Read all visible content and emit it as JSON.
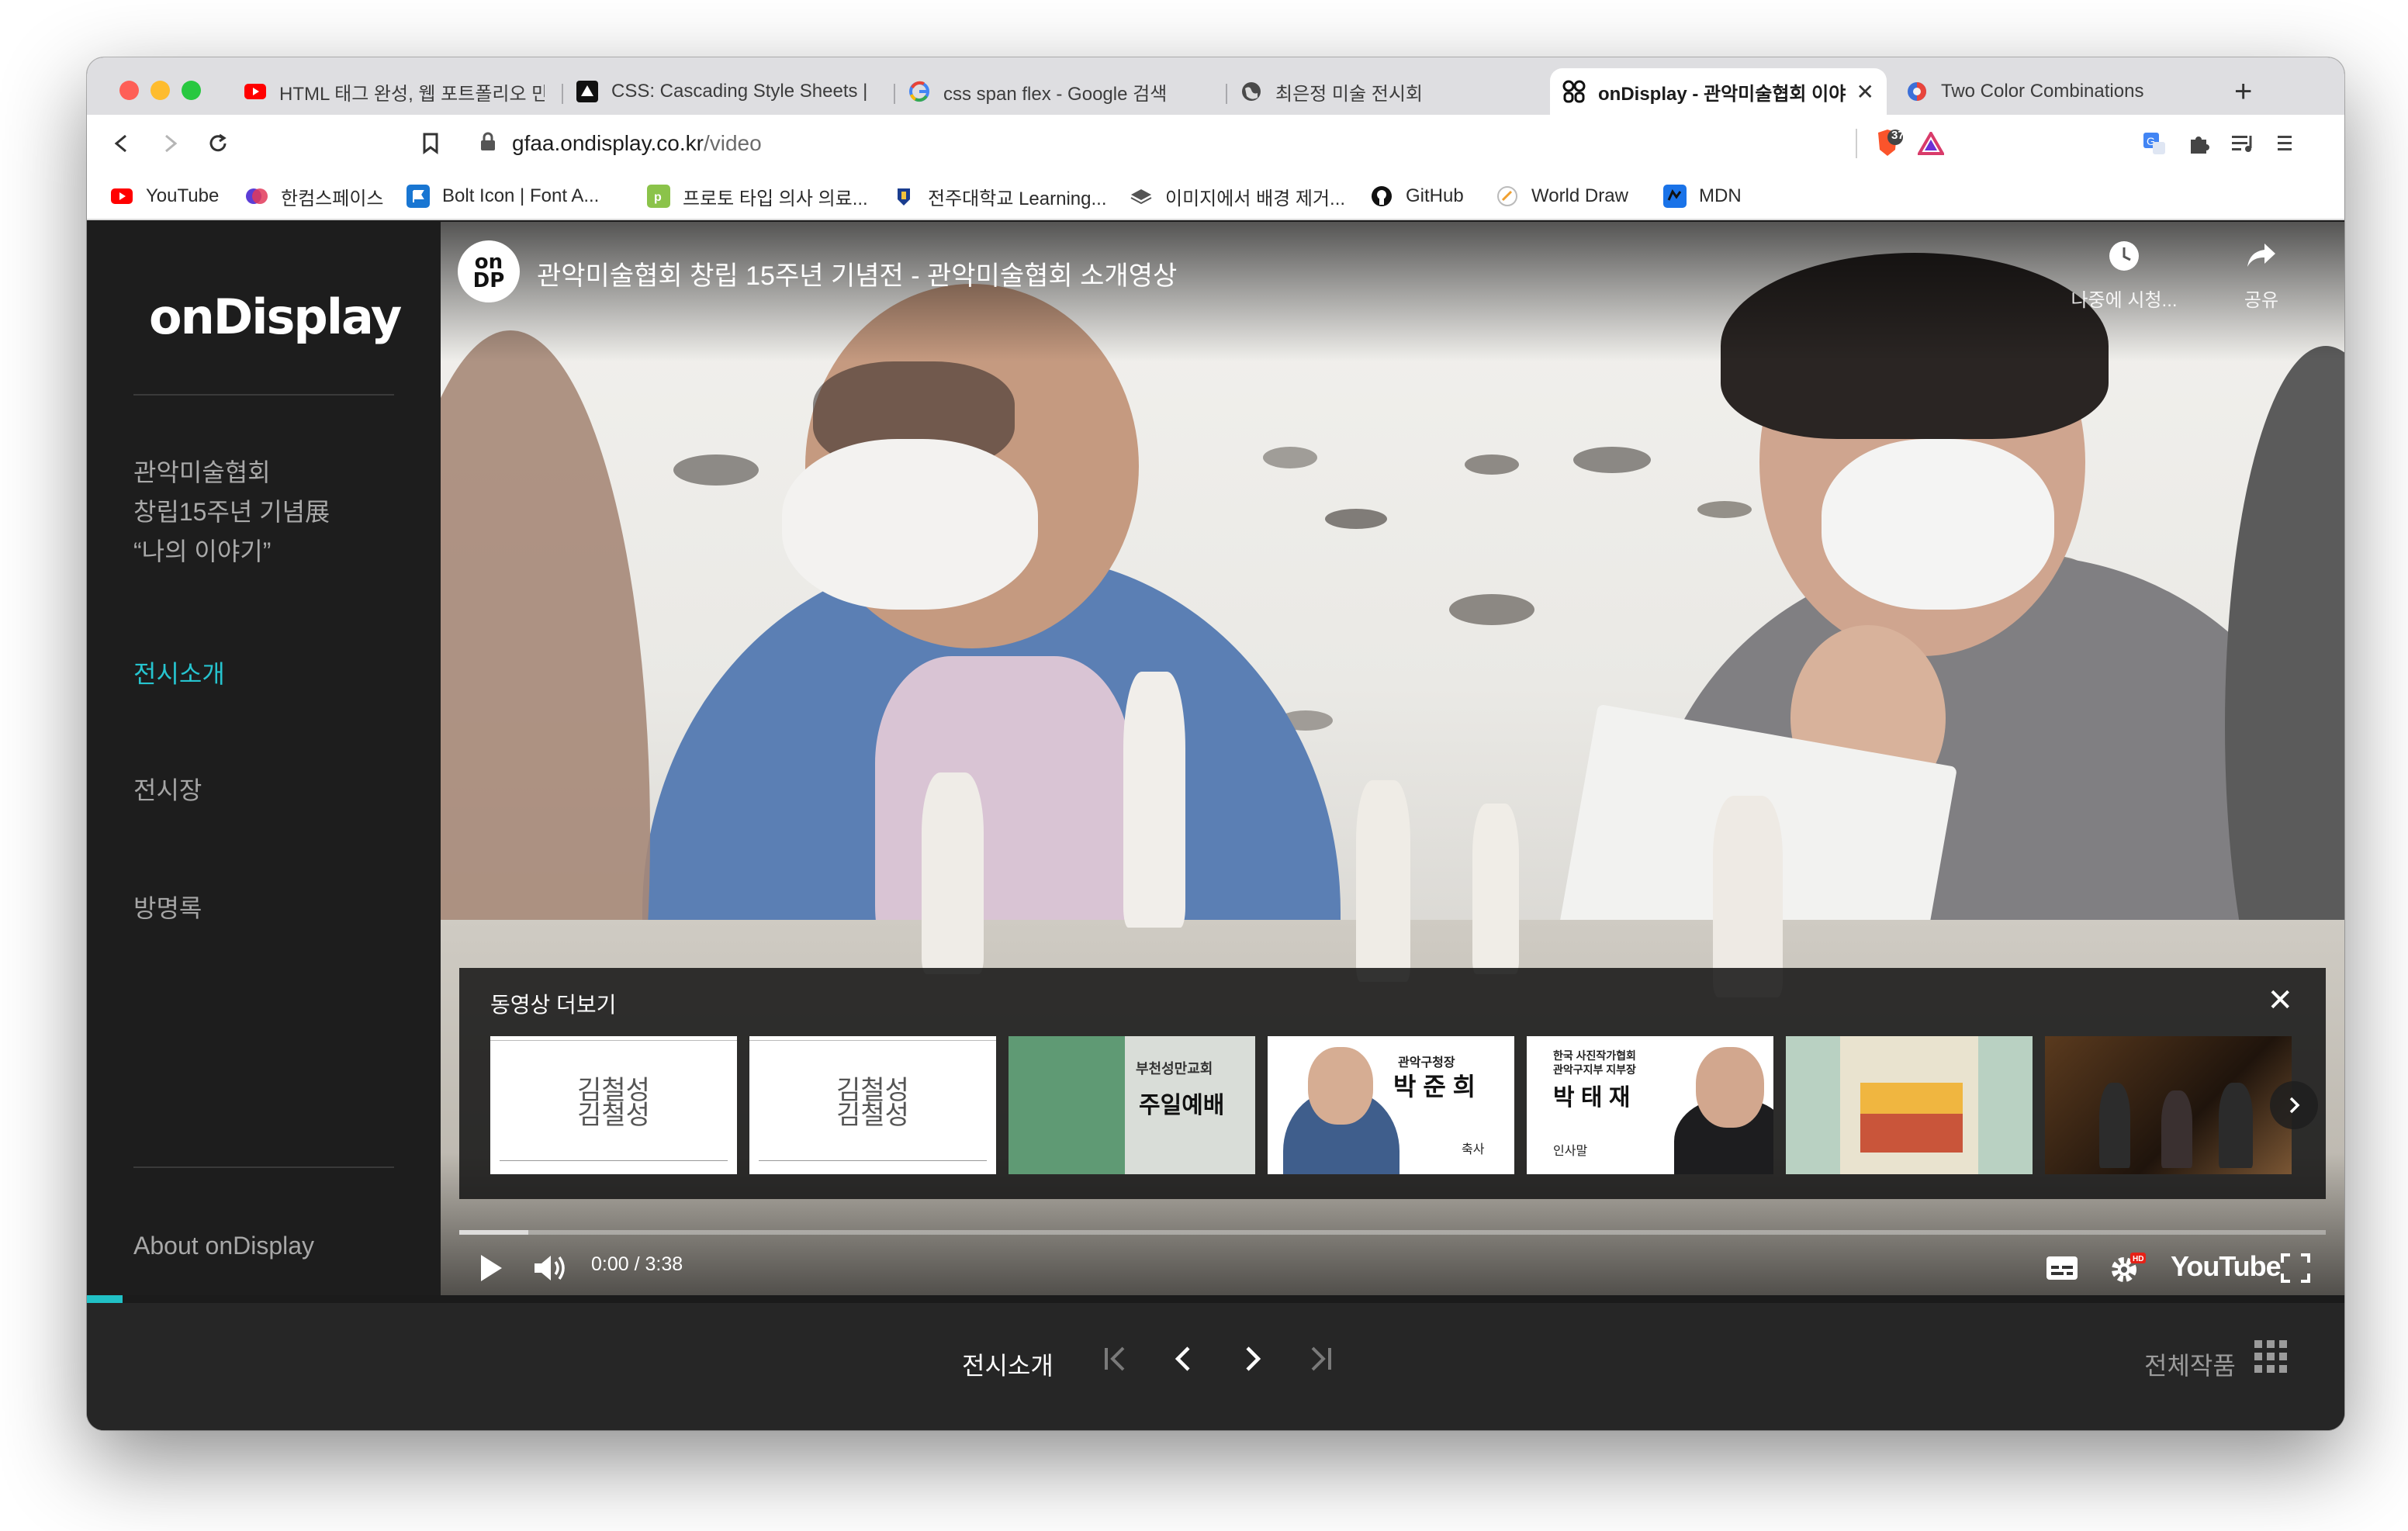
{
  "browser": {
    "tabs": [
      {
        "title": "HTML 태그 완성, 웹 포트폴리오 만들",
        "icon": "youtube-icon"
      },
      {
        "title": "CSS: Cascading Style Sheets |",
        "icon": "mdn-icon"
      },
      {
        "title": "css span flex - Google 검색",
        "icon": "google-icon"
      },
      {
        "title": "최은정 미술 전시회",
        "icon": "globe-icon"
      },
      {
        "title": "onDisplay - 관악미술협회 이야",
        "icon": "ondisplay-icon",
        "active": true
      },
      {
        "title": "Two Color Combinations",
        "icon": "globe-icon"
      }
    ],
    "url_host": "gfaa.ondisplay.co.kr",
    "url_path": "/video",
    "brave_badge": "37",
    "bookmarks": [
      {
        "label": "YouTube",
        "color": "#e62117"
      },
      {
        "label": "한컴스페이스",
        "color": "#5b3dd6"
      },
      {
        "label": "Bolt Icon | Font A...",
        "color": "#1976d2"
      },
      {
        "label": "프로토 타입 의사 의료...",
        "color": "#8bc34a"
      },
      {
        "label": "전주대학교 Learning...",
        "color": "#1a3d8f"
      },
      {
        "label": "이미지에서 배경 제거...",
        "color": "#555555"
      },
      {
        "label": "GitHub",
        "color": "#111111"
      },
      {
        "label": "World Draw",
        "color": "#f0c040"
      },
      {
        "label": "MDN",
        "color": "#1a73e8"
      }
    ]
  },
  "sidebar": {
    "logo": "onDisplay",
    "exhibition_title_line1": "관악미술협회",
    "exhibition_title_line2": "창립15주년 기념展",
    "exhibition_title_line3": "“나의 이야기”",
    "nav": [
      {
        "label": "전시소개",
        "active": true
      },
      {
        "label": "전시장",
        "active": false
      },
      {
        "label": "방명록",
        "active": false
      }
    ],
    "about": "About onDisplay"
  },
  "video": {
    "channel_avatar_text": "on\nDP",
    "title": "관악미술협회 창립 15주년 기념전 - 관악미술협회 소개영상",
    "watch_later": "나중에 시청...",
    "share": "공유",
    "more_videos_title": "동영상 더보기",
    "time": "0:00 / 3:38",
    "progress_fraction": 0,
    "buffered_fraction": 0.037,
    "youtube_logo": "YouTube",
    "thumbnails": [
      {
        "kind": "text",
        "main": "김철성\n김철성"
      },
      {
        "kind": "text",
        "main": "김철성\n김철성"
      },
      {
        "kind": "church",
        "main": "주일예배",
        "sub": "부천성만교회"
      },
      {
        "kind": "person",
        "role": "관악구청장",
        "name": "박 준 희",
        "tag": "축사"
      },
      {
        "kind": "person",
        "role": "한국 사진작가협회\n관악구지부 지부장",
        "name": "박 태 재",
        "tag": "인사말"
      },
      {
        "kind": "poster",
        "main": ""
      },
      {
        "kind": "concert",
        "main": ""
      }
    ]
  },
  "bottom_bar": {
    "section_label": "전시소개",
    "all_works": "전체작품"
  },
  "colors": {
    "accent_teal": "#21c1c6",
    "sidebar_bg": "#1d1d1d",
    "bottom_bar_bg": "#262626"
  }
}
